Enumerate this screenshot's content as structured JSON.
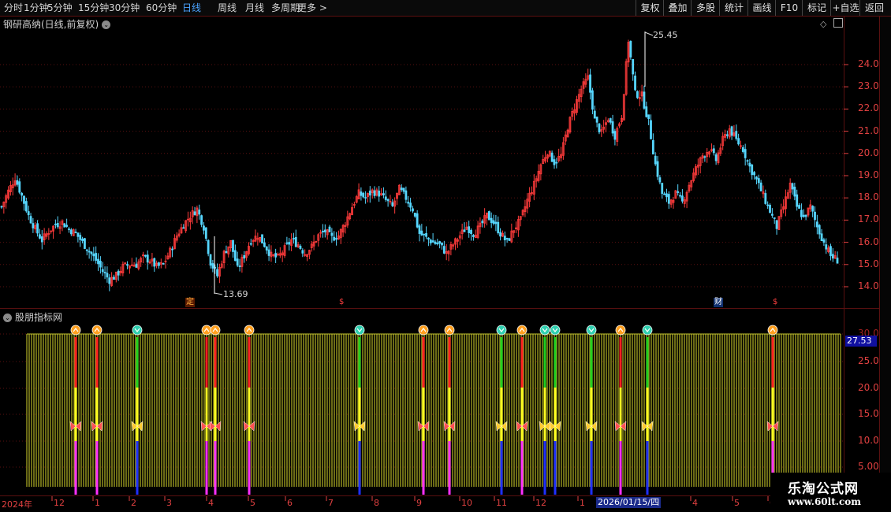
{
  "toolbar": {
    "periods": [
      "分时",
      "1分钟",
      "5分钟",
      "15分钟",
      "30分钟",
      "60分钟",
      "日线",
      "周线",
      "月线",
      "多周期",
      "更多 >"
    ],
    "active_period": "日线",
    "right_buttons": [
      "复权",
      "叠加",
      "多股",
      "统计",
      "画线",
      "F10",
      "标记",
      "+自选",
      "返回"
    ]
  },
  "main_chart": {
    "title": "钢研高纳(日线,前复权)",
    "y_labels": [
      "24.00",
      "23.00",
      "22.00",
      "21.00",
      "20.00",
      "19.00",
      "18.00",
      "17.00",
      "16.00",
      "15.00",
      "14.00"
    ],
    "high_label": "25.45",
    "low_label": "13.69",
    "badges": [
      "定",
      "$",
      "财",
      "$"
    ]
  },
  "indicator": {
    "title": "股朋指标网",
    "y_labels": [
      "30.00",
      "25.00",
      "20.00",
      "15.00",
      "10.00",
      "5.00"
    ],
    "current_value": "27.53"
  },
  "date_axis": {
    "year_label": "2024年",
    "months": [
      "12",
      "1",
      "2",
      "3",
      "4",
      "5",
      "6",
      "7",
      "8",
      "9",
      "10",
      "11",
      "12",
      "1",
      "4",
      "5",
      "6"
    ],
    "cursor_date": "2026/01/15/四"
  },
  "watermark": {
    "title": "乐淘公式网",
    "url": "www.60lt.com"
  },
  "colors": {
    "up": "#ff3b3b",
    "down": "#56d6ff",
    "grid": "#5a1010",
    "axis_text": "#e04040",
    "olive": "#9a9a20",
    "active": "#4aa3ff"
  },
  "chart_data": {
    "type": "candlestick",
    "y_range": [
      13.5,
      25.8
    ],
    "x_range_label": "2024-12 to 2026-06",
    "close_path": [
      17.6,
      18.3,
      18.9,
      18.1,
      17.2,
      16.6,
      16.1,
      16.5,
      16.8,
      16.9,
      16.6,
      16.4,
      16.0,
      15.6,
      15.2,
      14.7,
      14.3,
      14.5,
      14.9,
      15.0,
      15.0,
      15.3,
      15.2,
      14.9,
      15.0,
      15.6,
      16.3,
      16.8,
      17.2,
      17.5,
      16.7,
      15.1,
      14.5,
      15.5,
      16.0,
      14.8,
      15.4,
      16.1,
      16.3,
      15.9,
      15.4,
      15.3,
      15.7,
      16.1,
      15.9,
      15.5,
      15.8,
      16.3,
      16.5,
      16.2,
      16.3,
      16.9,
      17.6,
      18.2,
      18.0,
      18.3,
      18.2,
      17.9,
      17.6,
      18.4,
      18.0,
      17.5,
      16.4,
      16.2,
      16.0,
      15.9,
      15.5,
      15.9,
      16.3,
      16.7,
      16.4,
      16.7,
      17.2,
      16.9,
      16.4,
      16.0,
      16.6,
      17.0,
      17.9,
      18.6,
      19.5,
      20.1,
      19.6,
      19.9,
      21.2,
      22.1,
      22.9,
      23.4,
      21.5,
      20.9,
      21.6,
      20.8,
      21.7,
      25.1,
      22.7,
      22.6,
      21.4,
      19.5,
      18.2,
      17.8,
      18.2,
      17.8,
      18.6,
      19.3,
      19.9,
      20.2,
      19.7,
      20.6,
      21.1,
      20.6,
      20.2,
      19.4,
      18.8,
      18.1,
      17.4,
      16.7,
      17.6,
      18.6,
      17.6,
      17.1,
      17.6,
      16.7,
      16.0,
      15.4,
      15.2
    ],
    "high_marker": 25.45,
    "low_marker": 13.69,
    "indicator_markers": [
      {
        "type": "sell"
      },
      {
        "type": "sell"
      },
      {
        "type": "buy"
      },
      {
        "type": "sell"
      },
      {
        "type": "sell"
      },
      {
        "type": "sell"
      },
      {
        "type": "buy"
      },
      {
        "type": "sell"
      },
      {
        "type": "sell"
      },
      {
        "type": "buy"
      },
      {
        "type": "sell"
      },
      {
        "type": "buy"
      },
      {
        "type": "buy"
      },
      {
        "type": "buy"
      },
      {
        "type": "sell"
      },
      {
        "type": "buy"
      },
      {
        "type": "sell"
      }
    ],
    "indicator_background_level": 30.0
  }
}
